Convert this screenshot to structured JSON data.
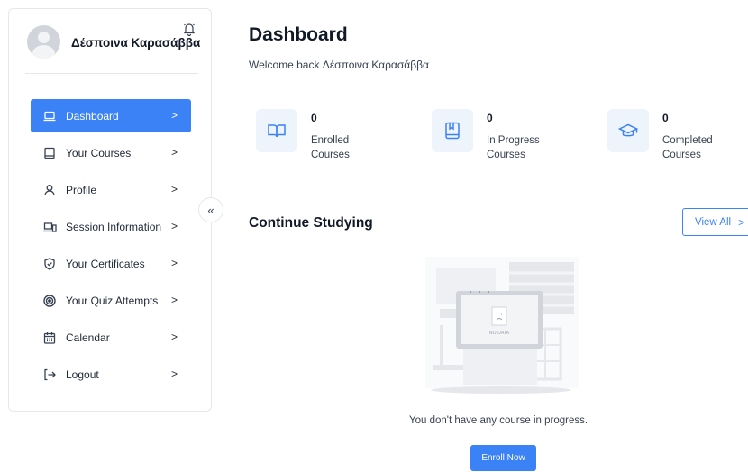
{
  "profile": {
    "name": "Δέσποινα Καρασάββα"
  },
  "menu": [
    {
      "label": "Dashboard",
      "icon": "laptop-icon",
      "active": true
    },
    {
      "label": "Your Courses",
      "icon": "tablet-icon",
      "active": false
    },
    {
      "label": "Profile",
      "icon": "user-icon",
      "active": false
    },
    {
      "label": "Session Information",
      "icon": "devices-icon",
      "active": false
    },
    {
      "label": "Your Certificates",
      "icon": "shield-check-icon",
      "active": false
    },
    {
      "label": "Your Quiz Attempts",
      "icon": "target-icon",
      "active": false
    },
    {
      "label": "Calendar",
      "icon": "calendar-icon",
      "active": false
    },
    {
      "label": "Logout",
      "icon": "logout-icon",
      "active": false
    }
  ],
  "menu_chevron": ">",
  "collapse_label": "«",
  "main": {
    "title": "Dashboard",
    "welcome": "Welcome back Δέσποινα Καρασάββα",
    "stats": [
      {
        "count": "0",
        "label": "Enrolled Courses",
        "icon": "book-open-icon"
      },
      {
        "count": "0",
        "label": "In Progress Courses",
        "icon": "bookmark-book-icon"
      },
      {
        "count": "0",
        "label": "Completed Courses",
        "icon": "graduation-cap-icon"
      }
    ],
    "continue_title": "Continue Studying",
    "view_all_label": "View All",
    "view_all_chevron": ">",
    "empty_state": {
      "illustration_text": "NO DATA",
      "message": "You don't have any course in progress.",
      "enroll_label": "Enroll Now"
    }
  },
  "colors": {
    "accent": "#3b82f6",
    "icon_bg": "#eef4fc"
  }
}
